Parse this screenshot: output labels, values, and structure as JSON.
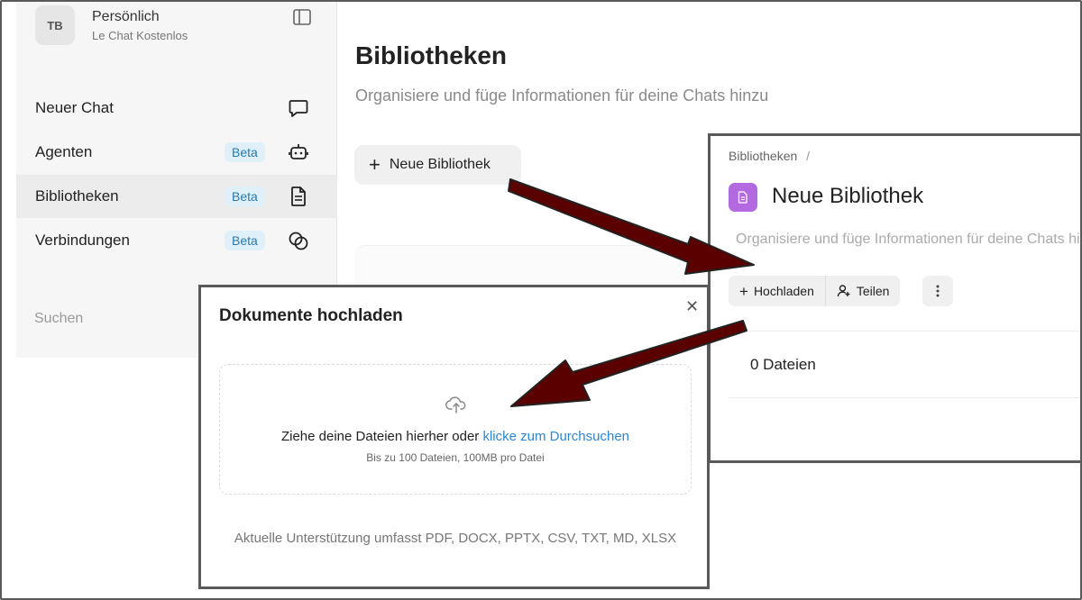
{
  "workspace": {
    "avatar_initials": "TB",
    "name": "Persönlich",
    "plan": "Le Chat Kostenlos"
  },
  "sidebar": {
    "items": [
      {
        "label": "Neuer Chat",
        "badge": "",
        "icon": "chat-bubble-icon"
      },
      {
        "label": "Agenten",
        "badge": "Beta",
        "icon": "robot-icon"
      },
      {
        "label": "Bibliotheken",
        "badge": "Beta",
        "icon": "document-icon"
      },
      {
        "label": "Verbindungen",
        "badge": "Beta",
        "icon": "link-circles-icon"
      }
    ],
    "search_label": "Suchen"
  },
  "main": {
    "title": "Bibliotheken",
    "subtitle": "Organisiere und füge Informationen für deine Chats hinzu",
    "new_library_label": "Neue Bibliothek"
  },
  "library_panel": {
    "breadcrumb": "Bibliotheken",
    "breadcrumb_sep": "/",
    "title": "Neue Bibliothek",
    "description_placeholder": "Organisiere und füge Informationen für deine Chats hinzu",
    "upload_label": "Hochladen",
    "share_label": "Teilen",
    "files_count": "0 Dateien"
  },
  "upload_modal": {
    "title": "Dokumente hochladen",
    "drop_text": "Ziehe deine Dateien hierher oder ",
    "browse_link": "klicke zum Durchsuchen",
    "limits": "Bis zu 100 Dateien, 100MB pro Datei",
    "support_text": "Aktuelle Unterstützung umfasst PDF, DOCX, PPTX, CSV, TXT, MD, XLSX"
  },
  "colors": {
    "arrow": "#5a0000",
    "beta_bg": "#dff0f8",
    "beta_text": "#2a7ab0",
    "library_icon": "#b36ae0",
    "link": "#2b87d1"
  }
}
